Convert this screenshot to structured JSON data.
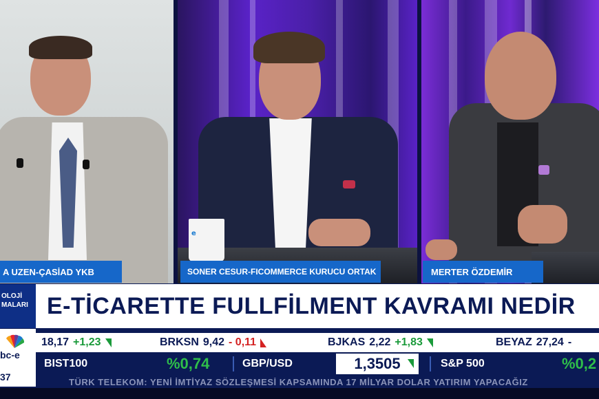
{
  "captions": {
    "left": "A UZEN-ÇASİAD YKB",
    "mid": "SONER CESUR-FICOMMERCE KURUCU ORTAK",
    "right": "MERTER ÖZDEMİR"
  },
  "mug_logo": "e",
  "side_tag": {
    "line1": "OLOJİ",
    "line2": "MALARI"
  },
  "headline": "E-TİCARETTE FULLFİLMENT KAVRAMI NEDİR",
  "channel": {
    "logo_text": "bc-e",
    "clock": "37"
  },
  "ticker": [
    {
      "name": "",
      "price": "18,17",
      "change": "+1,23",
      "direction": "up"
    },
    {
      "name": "BRKSN",
      "price": "9,42",
      "change": "- 0,11",
      "direction": "down"
    },
    {
      "name": "BJKAS",
      "price": "2,22",
      "change": "+1,83",
      "direction": "up"
    },
    {
      "name": "BEYAZ",
      "price": "27,24",
      "change": "-",
      "direction": "none"
    }
  ],
  "indices": [
    {
      "name": "BIST100",
      "value": "%0,74",
      "direction": "up"
    },
    {
      "name": "GBP/USD",
      "value": "1,3505",
      "direction": "up"
    },
    {
      "name": "S&P 500",
      "value": "%0,2",
      "direction": "up"
    }
  ],
  "crawl": "TÜRK TELEKOM: YENİ İMTİYAZ SÖZLEŞMESİ KAPSAMINDA 17 MİLYAR DOLAR YATIRIM YAPACAĞIZ",
  "colors": {
    "brand_blue": "#1667c9",
    "navy": "#0b1a55",
    "up_green": "#1a9a3a",
    "down_red": "#d42222"
  }
}
